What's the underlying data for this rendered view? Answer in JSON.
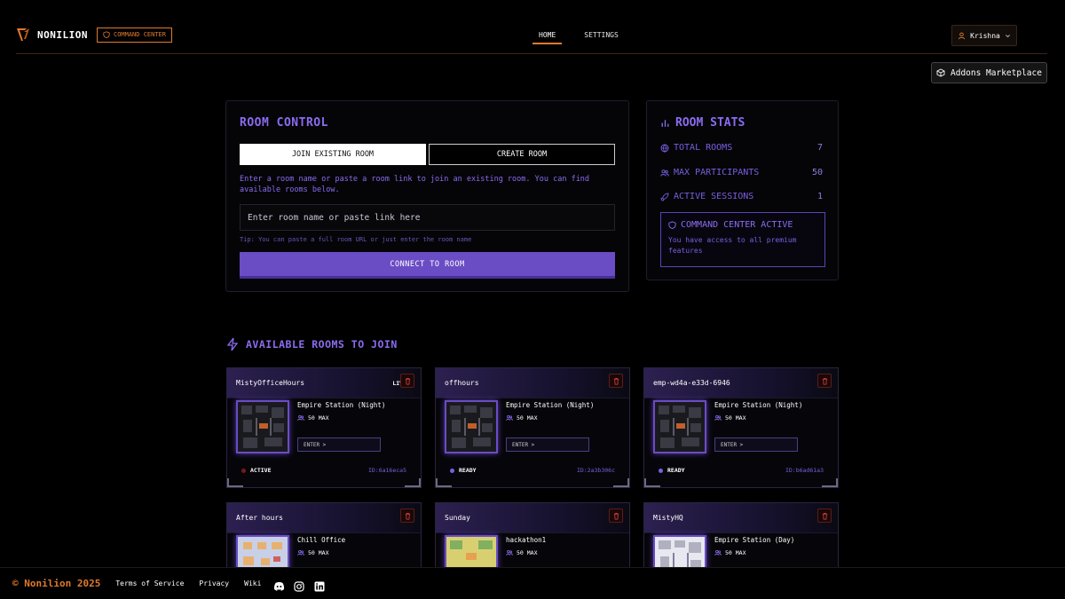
{
  "header": {
    "brand": "NONILION",
    "badge": "COMMAND CENTER",
    "nav": [
      {
        "label": "HOME",
        "active": true
      },
      {
        "label": "SETTINGS",
        "active": false
      }
    ],
    "user": "Krishna",
    "marketplace": "Addons Marketplace",
    "accent": "#e07a2b"
  },
  "room_control": {
    "title": "ROOM CONTROL",
    "tab_join": "JOIN EXISTING ROOM",
    "tab_create": "CREATE ROOM",
    "description": "Enter a room name or paste a room link to join an existing room. You can find available rooms below.",
    "input_placeholder": "Enter room name or paste link here",
    "tip": "Tip: You can paste a full room URL or just enter the room name",
    "connect": "CONNECT TO ROOM"
  },
  "room_stats": {
    "title": "ROOM STATS",
    "rows": [
      {
        "icon": "globe-icon",
        "label": "TOTAL ROOMS",
        "value": "7"
      },
      {
        "icon": "users-icon",
        "label": "MAX PARTICIPANTS",
        "value": "50"
      },
      {
        "icon": "rocket-icon",
        "label": "ACTIVE SESSIONS",
        "value": "1"
      }
    ],
    "cc_title": "COMMAND CENTER ACTIVE",
    "cc_desc": "You have access to all premium features"
  },
  "rooms_section": {
    "title": "AVAILABLE ROOMS TO JOIN",
    "rooms": [
      {
        "name": "MistyOfficeHours",
        "live": "LIVE",
        "map": "Empire Station (Night)",
        "capacity": "50 MAX",
        "enter": "ENTER >",
        "status": "ACTIVE",
        "status_color": "#7a1a1a",
        "id": "ID:6a16eca5",
        "thumb": "dark"
      },
      {
        "name": "offhours",
        "live": "",
        "map": "Empire Station (Night)",
        "capacity": "50 MAX",
        "enter": "ENTER >",
        "status": "READY",
        "status_color": "#7a5fe0",
        "id": "ID:2a3b306c",
        "thumb": "dark"
      },
      {
        "name": "emp-wd4a-e33d-6946",
        "live": "",
        "map": "Empire Station (Night)",
        "capacity": "50 MAX",
        "enter": "ENTER >",
        "status": "READY",
        "status_color": "#7a5fe0",
        "id": "ID:b6ad61a3",
        "thumb": "dark"
      },
      {
        "name": "After hours",
        "live": "",
        "map": "Chill Office",
        "capacity": "50 MAX",
        "enter": "",
        "status": "",
        "status_color": "",
        "id": "",
        "thumb": "chill"
      },
      {
        "name": "Sunday",
        "live": "",
        "map": "hackathon1",
        "capacity": "50 MAX",
        "enter": "",
        "status": "",
        "status_color": "",
        "id": "",
        "thumb": "hack"
      },
      {
        "name": "MistyHQ",
        "live": "",
        "map": "Empire Station (Day)",
        "capacity": "50 MAX",
        "enter": "",
        "status": "",
        "status_color": "",
        "id": "",
        "thumb": "day"
      }
    ]
  },
  "footer": {
    "copyright": "© Nonilion 2025",
    "links": [
      "Terms of Service",
      "Privacy",
      "Wiki"
    ],
    "social": [
      "discord-icon",
      "instagram-icon",
      "linkedin-icon"
    ]
  }
}
